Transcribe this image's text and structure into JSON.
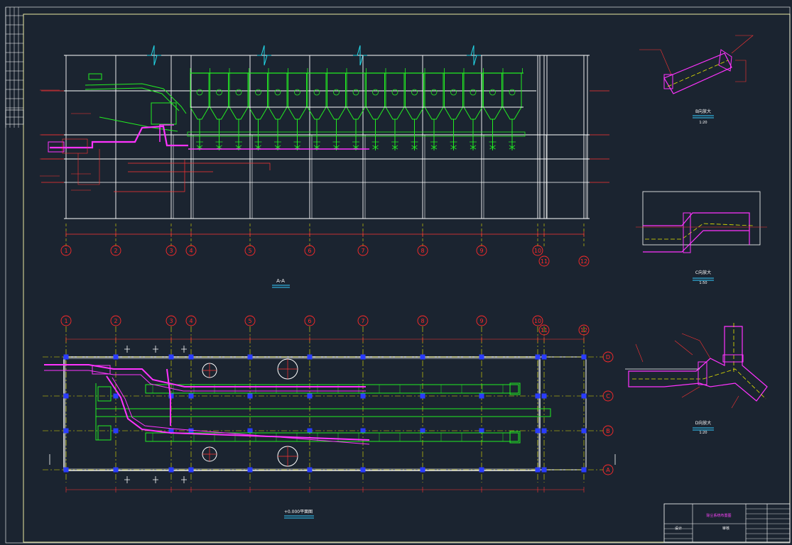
{
  "drawing": {
    "section_title": "A-A",
    "plan_title": "+0.000平面图",
    "detail_titles": [
      "B向放大",
      "C向放大",
      "D向放大"
    ],
    "detail_scales": [
      "1:20",
      "1:50",
      "1:20"
    ],
    "title_block_name": "除尘系统布置图",
    "title_block_labels": [
      "设计",
      "审核"
    ]
  },
  "axes": {
    "vertical": [
      "1",
      "2",
      "3",
      "4",
      "5",
      "6",
      "7",
      "8",
      "9",
      "10",
      "11",
      "12"
    ],
    "horizontal": [
      "D",
      "C",
      "B",
      "A"
    ]
  },
  "colors": {
    "background": "#1b2430",
    "border": "#e8e8a0",
    "structure": "#ffffff",
    "equipment": "#22ee22",
    "duct": "#ff33ff",
    "axis_bubble": "#ff2a2a",
    "dimension": "#ff3333",
    "centerline": "#e6e600",
    "break_line": "#22d8e8",
    "column": "#2a3cff",
    "caption": "#33ccff"
  }
}
